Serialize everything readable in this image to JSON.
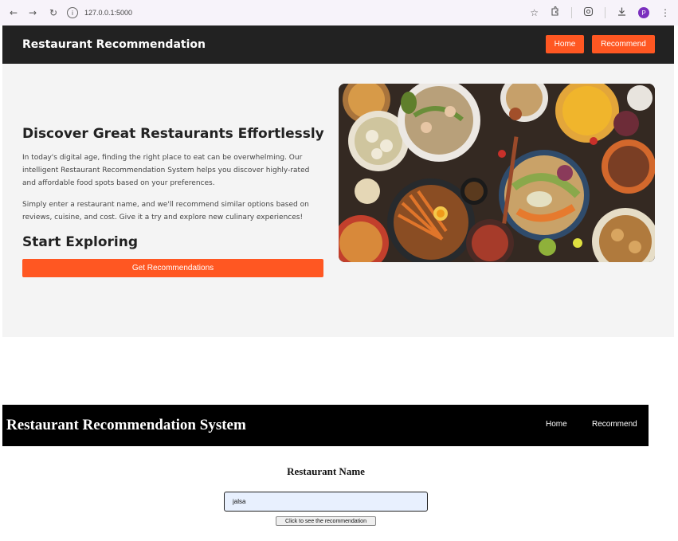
{
  "browser": {
    "url": "127.0.0.1:5000",
    "profile_initial": "P"
  },
  "site1": {
    "brand": "Restaurant Recommendation",
    "nav": {
      "home": "Home",
      "recommend": "Recommend"
    },
    "hero_title": "Discover Great Restaurants Effortlessly",
    "paragraph1": "In today's digital age, finding the right place to eat can be overwhelming. Our intelligent Restaurant Recommendation System helps you discover highly-rated and affordable food spots based on your preferences.",
    "paragraph2": "Simply enter a restaurant name, and we'll recommend similar options based on reviews, cuisine, and cost. Give it a try and explore new culinary experiences!",
    "explore_title": "Start Exploring",
    "cta": "Get Recommendations",
    "accent_color": "#ff5722"
  },
  "site2": {
    "brand": "Restaurant Recommendation System",
    "nav": {
      "home": "Home",
      "recommend": "Recommend"
    },
    "field_label": "Restaurant Name",
    "input_value": "jalsa",
    "submit_label": "Click to see the recommendation"
  }
}
